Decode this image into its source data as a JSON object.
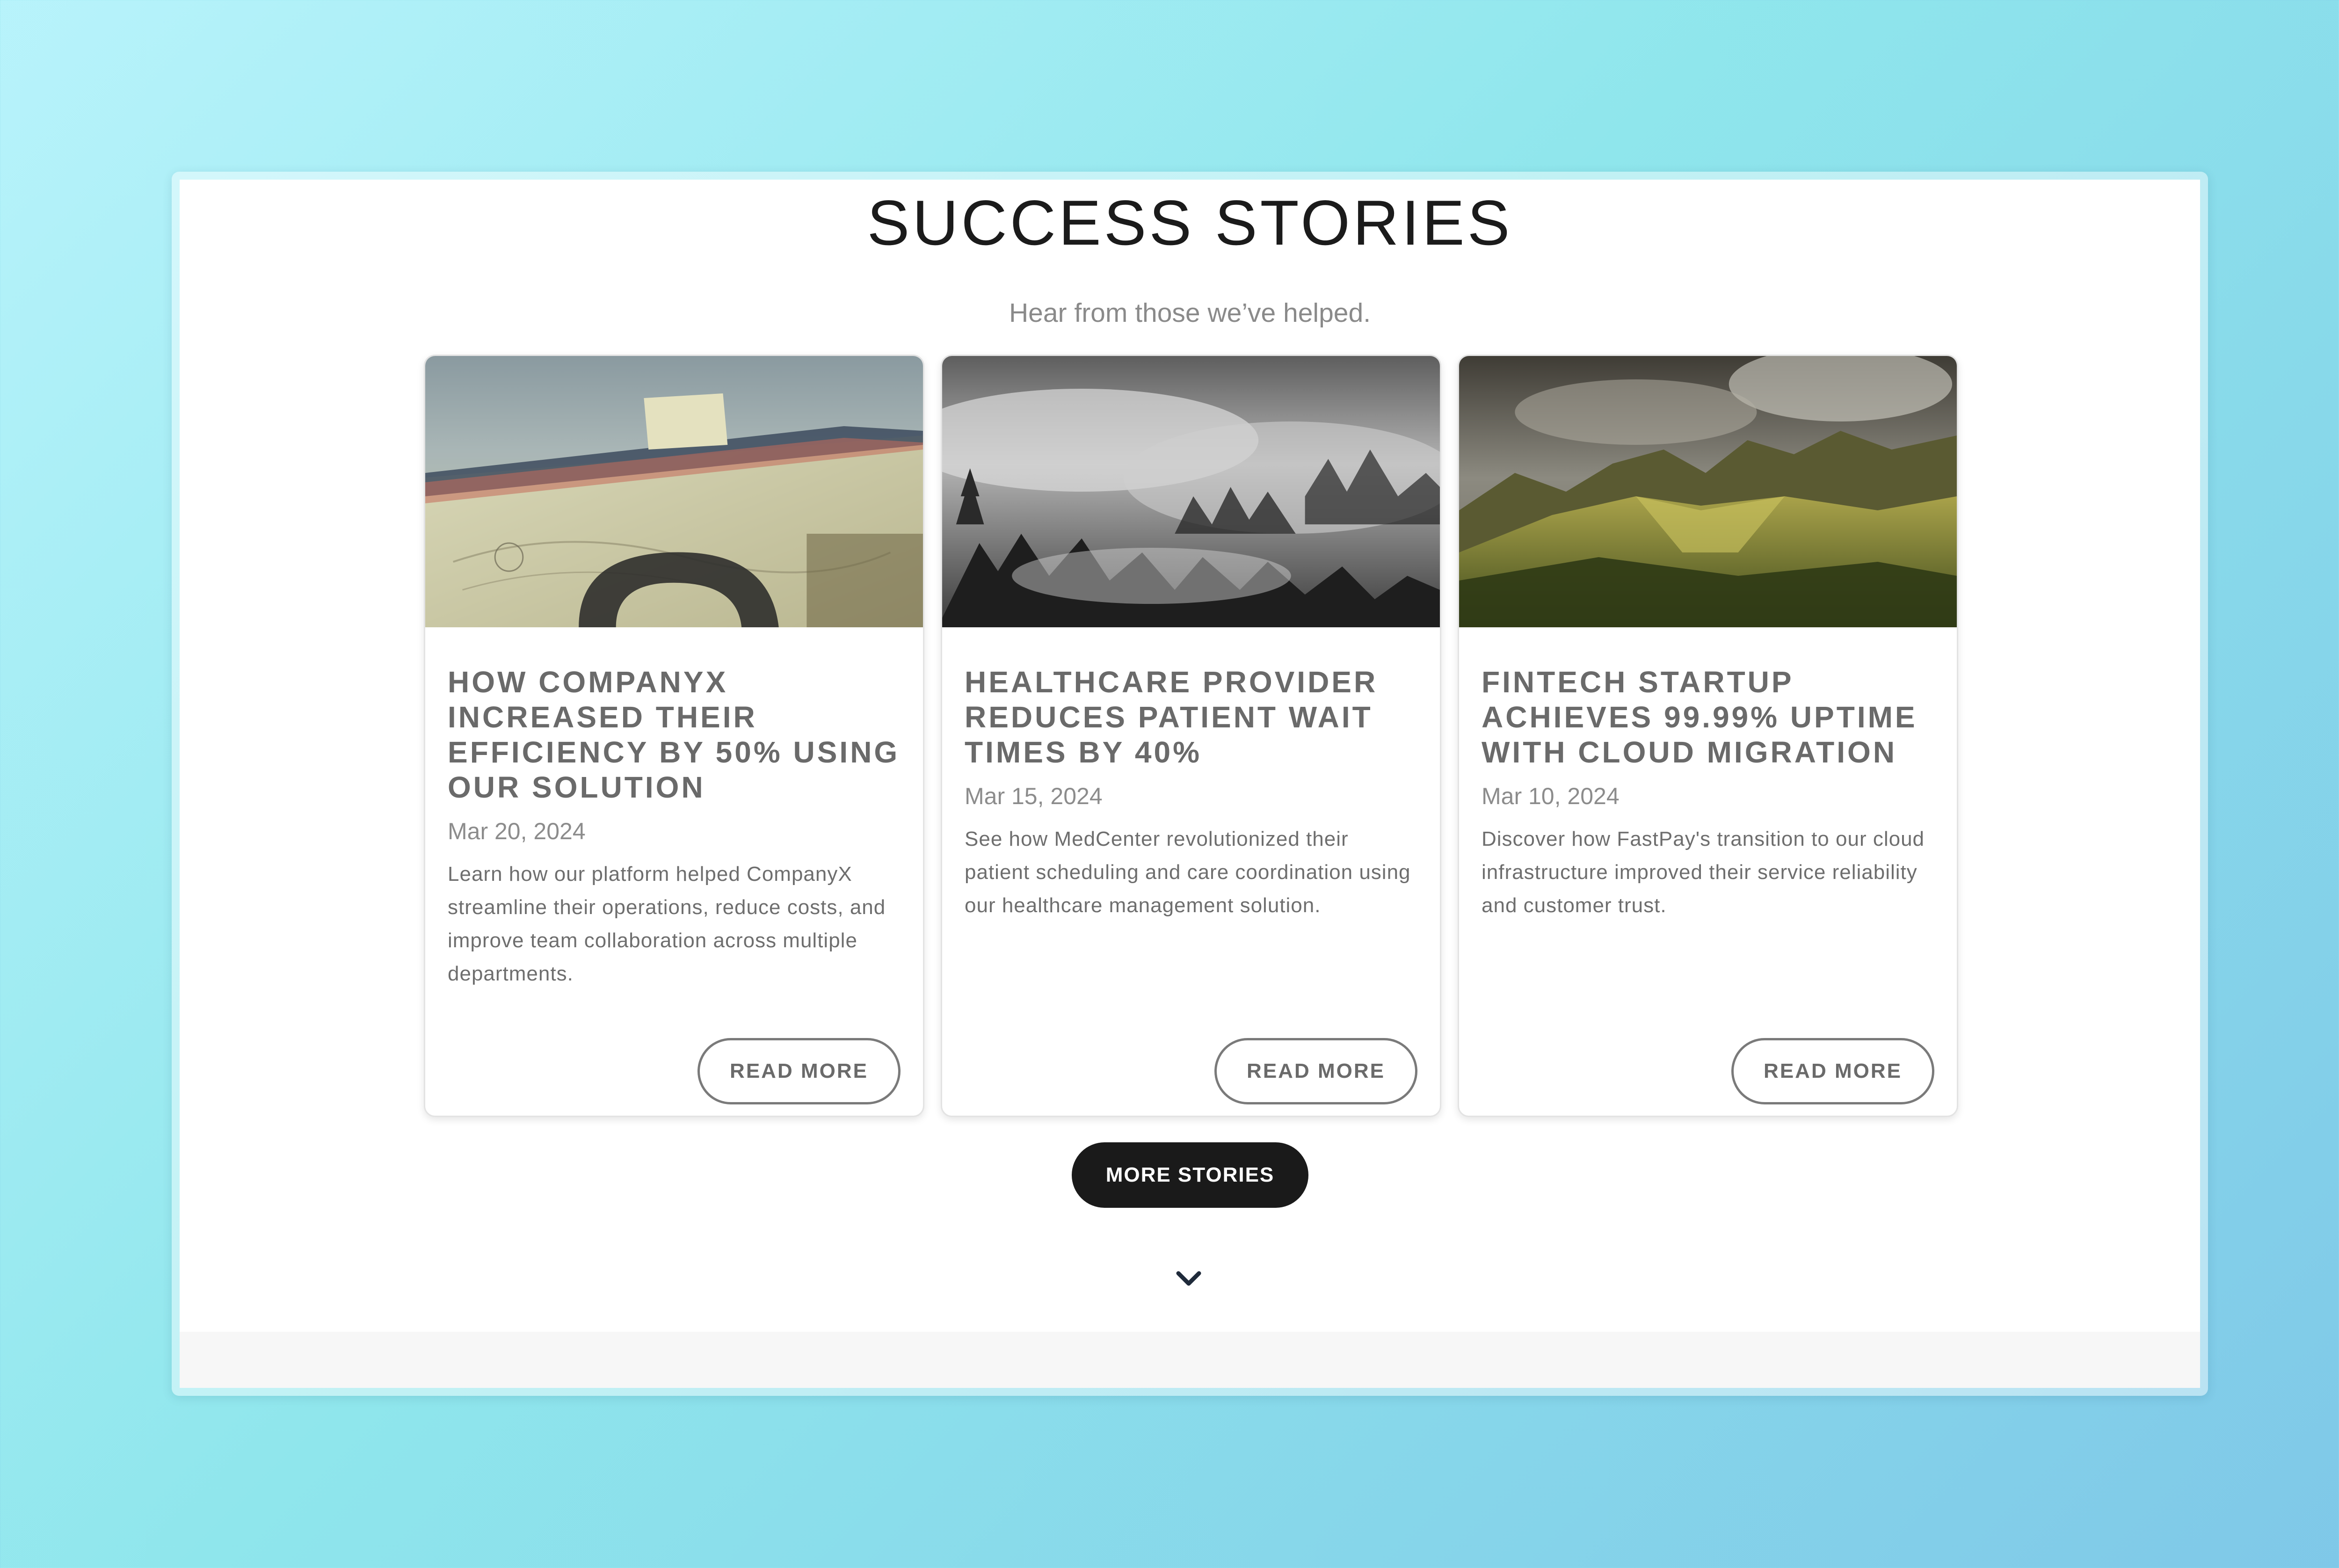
{
  "section": {
    "title": "SUCCESS STORIES",
    "subtitle": "Hear from those we’ve helped."
  },
  "stories": [
    {
      "title": "HOW COMPANYX INCREASED THEIR EFFICIENCY BY 50% USING OUR SOLUTION",
      "date": "Mar 20, 2024",
      "excerpt": "Learn how our platform helped CompanyX streamline their operations, reduce costs, and improve team collaboration across multiple departments.",
      "button_label": "READ MORE",
      "image": "blueprint-desk-photo"
    },
    {
      "title": "HEALTHCARE PROVIDER REDUCES PATIENT WAIT TIMES BY 40%",
      "date": "Mar 15, 2024",
      "excerpt": "See how MedCenter revolutionized their patient scheduling and care coordination using our healthcare management solution.",
      "button_label": "READ MORE",
      "image": "misty-forest-photo"
    },
    {
      "title": "FINTECH STARTUP ACHIEVES 99.99% UPTIME WITH CLOUD MIGRATION",
      "date": "Mar 10, 2024",
      "excerpt": "Discover how FastPay's transition to our cloud infrastructure improved their service reliability and customer trust.",
      "button_label": "READ MORE",
      "image": "mountain-valley-photo"
    }
  ],
  "actions": {
    "more_stories_label": "MORE STORIES",
    "scroll_icon": "chevron-down-icon"
  },
  "colors": {
    "background_gradient_start": "#b8f3fb",
    "background_gradient_end": "#7fc8e8",
    "primary_button": "#1a1a1a",
    "title_text": "#1b1b1b",
    "muted_text": "#8a8a8a"
  }
}
